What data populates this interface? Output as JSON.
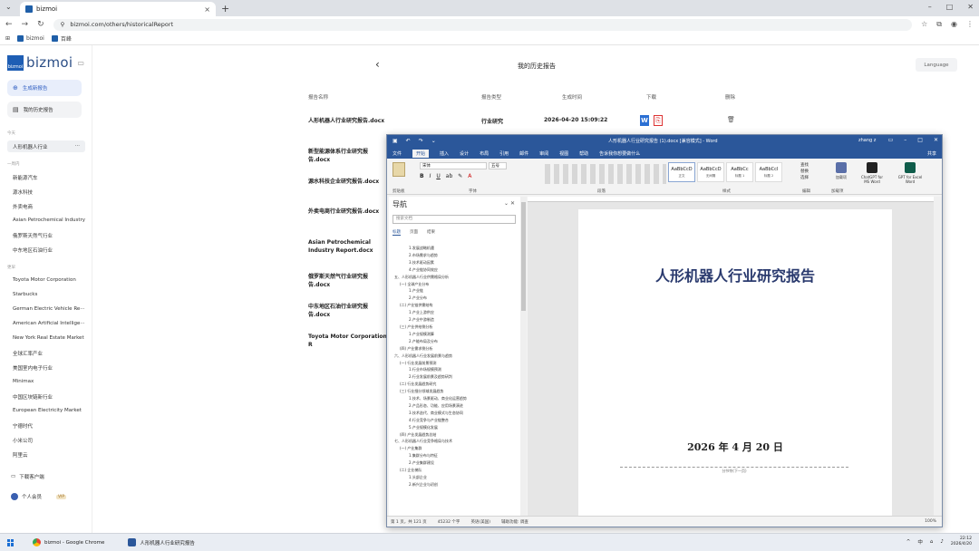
{
  "browser": {
    "tab_title": "bizmoi",
    "url": "bizmoi.com/others/historicalReport",
    "bookmarks": [
      "bizmoi",
      "百峰"
    ]
  },
  "sidebar": {
    "logo": "bizmoi",
    "logo_mark": "bizmoi",
    "new_report": "生成新报告",
    "my_reports": "我的历史报告",
    "section_recent": "今天",
    "selected_item": "人形机器人行业",
    "section_week": "一周内",
    "week_items": [
      "新能源汽车",
      "源水科技",
      "外卖电商",
      "Asian Petrochemical Industry",
      "俄罗斯天然气行业",
      "中东地区石油行业"
    ],
    "section_more": "更早",
    "more_items": [
      "Toyota Motor Corporation",
      "Starbucks",
      "German Electric Vehicle Re···",
      "American Artificial Intellige···",
      "New York Real Estate Market",
      "全球汇率产业",
      "美国室内电子行业",
      "Minimax",
      "中国区块链新行业",
      "European Electricity Market",
      "宁德时代",
      "小米公司",
      "阿里云"
    ],
    "download_client": "下载客户端",
    "user_label": "个人会员",
    "user_badge": "VIP"
  },
  "main": {
    "title": "我的历史报告",
    "language_button": "Language",
    "headers": {
      "name": "报告名称",
      "type": "报告类型",
      "time": "生成时间",
      "download": "下载",
      "delete": "删除"
    },
    "rows": [
      {
        "name": "人形机器人行业研究报告.docx",
        "type": "行业研究",
        "time": "2026-04-20 15:09:22"
      },
      {
        "name": "新型能源体系行业研究报告.docx"
      },
      {
        "name": "源水科技企业研究报告.docx"
      },
      {
        "name": "外卖电商行业研究报告.docx"
      },
      {
        "name": "Asian Petrochemical Industry Report.docx"
      },
      {
        "name": "俄罗斯天然气行业研究报告.docx"
      },
      {
        "name": "中东地区石油行业研究报告.docx"
      },
      {
        "name": "Toyota Motor Corporation R"
      }
    ]
  },
  "word": {
    "title": "人形机器人行业研究报告 (1).docx [兼容模式] - Word",
    "user": "zhang z",
    "tabs": [
      "文件",
      "开始",
      "插入",
      "设计",
      "布局",
      "引用",
      "邮件",
      "审阅",
      "视图",
      "帮助",
      "告诉我你想要做什么"
    ],
    "share": "共享",
    "font_name": "宋体",
    "font_size": "五号",
    "styles": [
      {
        "preview": "AaBbCcD",
        "label": "正文"
      },
      {
        "preview": "AaBbCcD",
        "label": "无间隔"
      },
      {
        "preview": "AaBbCc",
        "label": "标题 1"
      },
      {
        "preview": "AaBbCcI",
        "label": "标题 2"
      }
    ],
    "editing": [
      "查找",
      "替换",
      "选择"
    ],
    "addins": [
      {
        "label": "加载项"
      },
      {
        "label": "ChatGPT for MS Word"
      },
      {
        "label": "GPT for Excel Word"
      }
    ],
    "group_labels": [
      "剪贴板",
      "字体",
      "段落",
      "样式",
      "编辑",
      "加载项"
    ],
    "nav_title": "导航",
    "nav_search": "搜索文档",
    "nav_tabs": [
      "标题",
      "页面",
      "结果"
    ],
    "outline": [
      {
        "level": 3,
        "text": "1.发展战略机遇"
      },
      {
        "level": 3,
        "text": "2.市场需求与趋势"
      },
      {
        "level": 3,
        "text": "3.技术驱动因素"
      },
      {
        "level": 3,
        "text": "4.产业链协同效应"
      },
      {
        "level": 1,
        "text": "五、人形机器人行业供需格局分析"
      },
      {
        "level": 2,
        "text": "(一) 全球产业分布"
      },
      {
        "level": 3,
        "text": "1.产业链"
      },
      {
        "level": 3,
        "text": "2.产业分布"
      },
      {
        "level": 2,
        "text": "(二) 产业链供需结构"
      },
      {
        "level": 3,
        "text": "1.产业上游供应"
      },
      {
        "level": 3,
        "text": "2.产业中游制造"
      },
      {
        "level": 2,
        "text": "(三) 产业供给侧分析"
      },
      {
        "level": 3,
        "text": "1.产业规模测算"
      },
      {
        "level": 3,
        "text": "2.产能布局及分布"
      },
      {
        "level": 2,
        "text": "(四) 产业需求侧分析"
      },
      {
        "level": 1,
        "text": "六、人形机器人行业发展前景与趋势"
      },
      {
        "level": 2,
        "text": "(一) 行业发展前景预测"
      },
      {
        "level": 3,
        "text": "1.行业市场规模预测"
      },
      {
        "level": 3,
        "text": "2.行业发展前景及趋势研判"
      },
      {
        "level": 2,
        "text": "(二) 行业发展趋势研究"
      },
      {
        "level": 2,
        "text": "(三) 行业细分领域发展趋势"
      },
      {
        "level": 3,
        "text": "1.技术、场景驱动、商业化运营趋势"
      },
      {
        "level": 3,
        "text": "2.产品形态、功能、应用场景演进"
      },
      {
        "level": 3,
        "text": "3.技术迭代、商业模式与生态协同"
      },
      {
        "level": 3,
        "text": "4.行业竞争与产业链整合"
      },
      {
        "level": 3,
        "text": "5.产业规模化发展"
      },
      {
        "level": 2,
        "text": "(四) 产业发展趋势总结"
      },
      {
        "level": 1,
        "text": "七、人形机器人行业竞争格局与技术"
      },
      {
        "level": 2,
        "text": "(一) 产业集群"
      },
      {
        "level": 3,
        "text": "1.集群分布与特征"
      },
      {
        "level": 3,
        "text": "2.产业集群建设"
      },
      {
        "level": 2,
        "text": "(二) 企业梯队"
      },
      {
        "level": 3,
        "text": "1.头部企业"
      },
      {
        "level": 3,
        "text": "2.新兴企业与初创"
      }
    ],
    "doc_title": "人形机器人行业研究报告",
    "doc_date": "2026 年 4 月 20 日",
    "doc_footer": "分节符(下一页)",
    "status": [
      "第 1 页，共 121 页",
      "45232 个字",
      "英语(美国)",
      "辅助功能: 调查"
    ],
    "zoom": "100%"
  },
  "taskbar": {
    "apps": [
      "bizmoi - Google Chrome",
      "人形机器人行业研究报告"
    ],
    "ime": "中",
    "time": "22:12",
    "date": "2026/4/20"
  }
}
